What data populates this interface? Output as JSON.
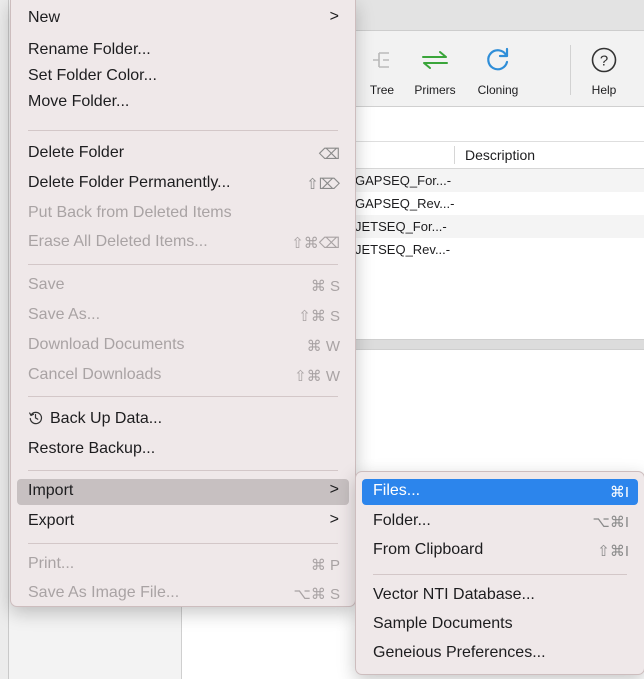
{
  "toolbar": {
    "buttons": [
      {
        "label": "le",
        "icon": "partial-icon"
      },
      {
        "label": "Tree",
        "icon": "tree-icon"
      },
      {
        "label": "Primers",
        "icon": "primers-icon"
      },
      {
        "label": "Cloning",
        "icon": "cloning-icon"
      },
      {
        "label": "Help",
        "icon": "help-icon"
      }
    ]
  },
  "table": {
    "header_description": "Description",
    "rows": [
      {
        "name": "GAPSEQ_For...",
        "description": "-"
      },
      {
        "name": "GAPSEQ_Rev...",
        "description": "-"
      },
      {
        "name": "JETSEQ_For...",
        "description": "-"
      },
      {
        "name": "JETSEQ_Rev...",
        "description": "-"
      }
    ]
  },
  "main_menu": {
    "items": [
      {
        "label": "New",
        "shortcut": "",
        "submenu": true,
        "disabled": false
      },
      {
        "label": "Rename Folder...",
        "shortcut": "",
        "disabled": false
      },
      {
        "label": "Set Folder Color...",
        "shortcut": "",
        "disabled": false
      },
      {
        "label": "Move Folder...",
        "shortcut": "",
        "disabled": false
      },
      {
        "label": "Delete Folder",
        "shortcut": "⌫",
        "disabled": false
      },
      {
        "label": "Delete Folder Permanently...",
        "shortcut": "⇧⌦",
        "disabled": false
      },
      {
        "label": "Put Back from Deleted Items",
        "shortcut": "",
        "disabled": true
      },
      {
        "label": "Erase All Deleted Items...",
        "shortcut": "⇧⌘⌫",
        "disabled": true
      },
      {
        "label": "Save",
        "shortcut": "⌘ S",
        "disabled": true
      },
      {
        "label": "Save As...",
        "shortcut": "⇧⌘ S",
        "disabled": true
      },
      {
        "label": "Download Documents",
        "shortcut": "⌘ W",
        "disabled": true
      },
      {
        "label": "Cancel Downloads",
        "shortcut": "⇧⌘ W",
        "disabled": true
      },
      {
        "label": "Back Up Data...",
        "shortcut": "",
        "icon": "backup-clock-icon",
        "disabled": false
      },
      {
        "label": "Restore Backup...",
        "shortcut": "",
        "disabled": false
      },
      {
        "label": "Import",
        "shortcut": "",
        "submenu": true,
        "disabled": false
      },
      {
        "label": "Export",
        "shortcut": "",
        "submenu": true,
        "disabled": false
      },
      {
        "label": "Print...",
        "shortcut": "⌘ P",
        "disabled": true
      },
      {
        "label": "Save As Image File...",
        "shortcut": "⌥⌘ S",
        "disabled": true
      }
    ]
  },
  "import_submenu": {
    "items": [
      {
        "label": "Files...",
        "shortcut": "⌘I",
        "selected": true
      },
      {
        "label": "Folder...",
        "shortcut": "⌥⌘I"
      },
      {
        "label": "From Clipboard",
        "shortcut": "⇧⌘I"
      },
      {
        "label": "Vector NTI Database...",
        "shortcut": ""
      },
      {
        "label": "Sample Documents",
        "shortcut": ""
      },
      {
        "label": "Geneious Preferences...",
        "shortcut": ""
      }
    ]
  },
  "colors": {
    "menu_bg": "#efe8e9",
    "highlight_blue": "#2c85ec",
    "hover_gray": "#c7c0c1",
    "primers_green": "#3aa53a",
    "cloning_blue": "#2f8ed8"
  }
}
